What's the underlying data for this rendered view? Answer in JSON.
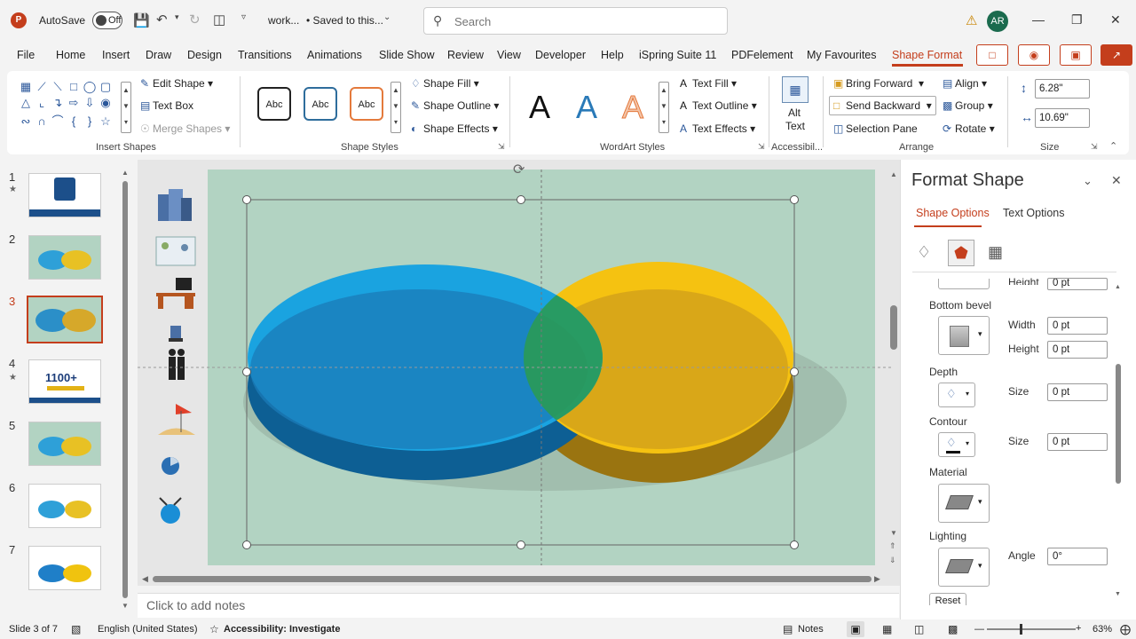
{
  "titlebar": {
    "logo": "P",
    "autosave_label": "AutoSave",
    "autosave_state": "Off",
    "doc_title": "work...",
    "doc_status": "• Saved to this...",
    "search_placeholder": "Search",
    "avatar_initials": "AR"
  },
  "menu": {
    "tabs": [
      "File",
      "Home",
      "Insert",
      "Draw",
      "Design",
      "Transitions",
      "Animations",
      "Slide Show",
      "Review",
      "View",
      "Developer",
      "Help",
      "iSpring Suite 11",
      "PDFelement",
      "My Favourites",
      "Shape Format"
    ],
    "active": "Shape Format"
  },
  "ribbon": {
    "insert_shapes": {
      "edit_shape": "Edit Shape",
      "text_box": "Text Box",
      "merge_shapes": "Merge Shapes",
      "label": "Insert Shapes"
    },
    "shape_styles": {
      "abc": [
        "Abc",
        "Abc",
        "Abc"
      ],
      "shape_fill": "Shape Fill",
      "shape_outline": "Shape Outline",
      "shape_effects": "Shape Effects",
      "label": "Shape Styles"
    },
    "wordart": {
      "letters": [
        "A",
        "A",
        "A"
      ],
      "text_fill": "Text Fill",
      "text_outline": "Text Outline",
      "text_effects": "Text Effects",
      "label": "WordArt Styles"
    },
    "accessibility": {
      "alt_text_1": "Alt",
      "alt_text_2": "Text",
      "label": "Accessibil..."
    },
    "arrange": {
      "bring_forward": "Bring Forward",
      "send_backward": "Send Backward",
      "selection_pane": "Selection Pane",
      "align": "Align",
      "group": "Group",
      "rotate": "Rotate",
      "label": "Arrange"
    },
    "size": {
      "height": "6.28\"",
      "width": "10.69\"",
      "label": "Size"
    }
  },
  "slides": {
    "numbers": [
      "1",
      "2",
      "3",
      "4",
      "5",
      "6",
      "7"
    ],
    "active": "3",
    "thumb_texts": {
      "s4": "1100+"
    }
  },
  "notes_placeholder": "Click to add notes",
  "format_pane": {
    "title": "Format Shape",
    "tabs": [
      "Shape Options",
      "Text Options"
    ],
    "partial_label": "Height",
    "partial_value": "0 pt",
    "bottom_bevel": "Bottom bevel",
    "width_label": "Width",
    "width_value": "0 pt",
    "height_label": "Height",
    "height_value": "0 pt",
    "depth": "Depth",
    "depth_size_label": "Size",
    "depth_size_value": "0 pt",
    "contour": "Contour",
    "contour_size_label": "Size",
    "contour_size_value": "0 pt",
    "material": "Material",
    "lighting": "Lighting",
    "angle_label": "Angle",
    "angle_value": "0°",
    "reset": "Reset"
  },
  "status": {
    "slide_info": "Slide 3 of 7",
    "language": "English (United States)",
    "accessibility": "Accessibility: Investigate",
    "notes": "Notes",
    "zoom": "63%"
  },
  "colors": {
    "accent": "#c43e1c",
    "slide_bg": "#b2d3c2",
    "blue_ellipse": "#1aa3e0",
    "yellow_ellipse": "#f5c211",
    "overlap": "#2a9a55"
  }
}
